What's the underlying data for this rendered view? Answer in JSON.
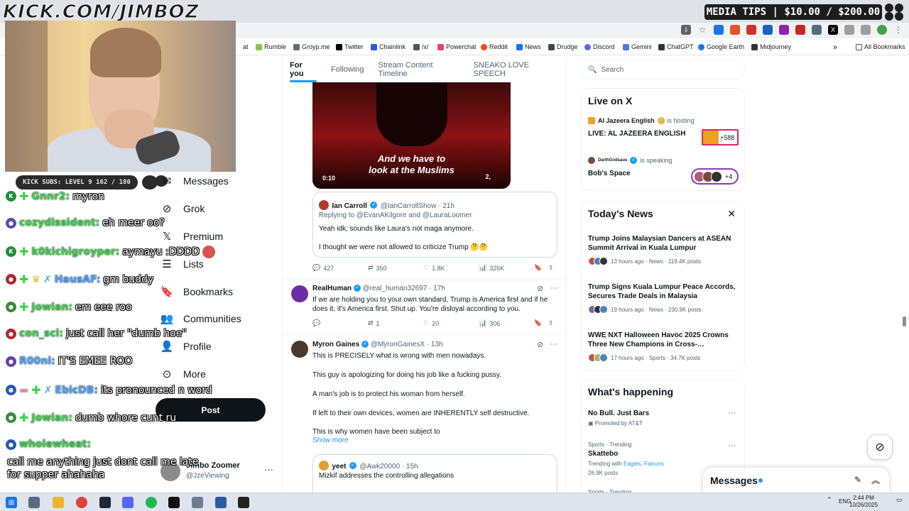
{
  "overlay": {
    "stream_url": "KICK.COM/JIMBOZ",
    "media_tips": "MEDIA TIPS | $10.00 / $200.00",
    "kick_subs": "KICK SUBS: LEVEL 9 162 / 180"
  },
  "bookmarks": [
    {
      "label": "at",
      "color": "#ffffff"
    },
    {
      "label": "Rumble",
      "color": "#85c742"
    },
    {
      "label": "Groyp.me",
      "color": "#6b6b6b"
    },
    {
      "label": "Twitter",
      "color": "#000000"
    },
    {
      "label": "Chainlink",
      "color": "#2a5ada"
    },
    {
      "label": "/x/",
      "color": "#555555"
    },
    {
      "label": "Powerchat",
      "color": "#e0467c"
    },
    {
      "label": "Reddit",
      "color": "#ff4500"
    },
    {
      "label": "News",
      "color": "#1a73e8"
    },
    {
      "label": "Drudge",
      "color": "#444444"
    },
    {
      "label": "Discord",
      "color": "#5865f2"
    },
    {
      "label": "Gemini",
      "color": "#4a7be0"
    },
    {
      "label": "ChatGPT",
      "color": "#333333"
    },
    {
      "label": "Google Earth",
      "color": "#1a73e8"
    },
    {
      "label": "Midjourney",
      "color": "#333333"
    }
  ],
  "all_bookmarks": "All Bookmarks",
  "nav": [
    {
      "label": "Messages",
      "icon": "envelope-icon"
    },
    {
      "label": "Grok",
      "icon": "grok-icon"
    },
    {
      "label": "Premium",
      "icon": "x-logo-icon"
    },
    {
      "label": "Lists",
      "icon": "list-icon"
    },
    {
      "label": "Bookmarks",
      "icon": "bookmark-icon"
    },
    {
      "label": "Communities",
      "icon": "people-icon"
    },
    {
      "label": "Profile",
      "icon": "person-icon"
    },
    {
      "label": "More",
      "icon": "more-circle-icon"
    }
  ],
  "post_button": "Post",
  "account": {
    "name": "Jimbo Zoomer",
    "handle": "@JzeViewing"
  },
  "chat": [
    {
      "user": "Gnnr2:",
      "msg": "myron",
      "user_color": "#3cd24a",
      "badge_color": "#1f8f3a"
    },
    {
      "user": "cozydissident:",
      "msg": "eh meer oo?",
      "user_color": "#3cd24a",
      "badge_color": "#5b4bb0"
    },
    {
      "user": "k0kichigroyper:",
      "msg": "aymayu :DDDD",
      "user_color": "#3cd24a",
      "badge_color": "#1f8f3a"
    },
    {
      "user": "HausAF:",
      "msg": "gm buddy",
      "user_color": "#4aa3ff",
      "badge_color": "#b0262e"
    },
    {
      "user": "Jowian:",
      "msg": "em eee roo",
      "user_color": "#3cd24a",
      "badge_color": "#3a8a3a"
    },
    {
      "user": "con_sci:",
      "msg": "just call her \"dumb hoe\"",
      "user_color": "#3cd24a",
      "badge_color": "#b0262e"
    },
    {
      "user": "R00ni:",
      "msg": "IT'S EMEE ROO",
      "user_color": "#4aa3ff",
      "badge_color": "#6a3fa3"
    },
    {
      "user": "EbicDB:",
      "msg": "its pronounced n word",
      "user_color": "#4aa3ff",
      "badge_color": "#2a5ab0"
    },
    {
      "user": "Jowian:",
      "msg": "dumb whore cunt ru",
      "user_color": "#3cd24a",
      "badge_color": "#3a8a3a"
    },
    {
      "user": "wholewheat:",
      "msg": "",
      "user_color": "#3cd24a",
      "badge_color": "#2a5ab0"
    }
  ],
  "chat_multiline": "call me anything just dont call me late for supper ahahaha",
  "tabs": [
    "For you",
    "Following",
    "Stream Content Timeline",
    "SNEAKO LOVE SPEECH"
  ],
  "video": {
    "caption_line1": "And we have to",
    "caption_line2": "look at the Muslims",
    "time": "0:10",
    "time2": "2,"
  },
  "quote1": {
    "name": "Ian Carroll",
    "handle": "@IanCarrollShow · 21h",
    "replying": "Replying to @EvanAKilgore and @LauraLoomer",
    "line1": "Yeah idk, sounds like Laura's not maga anymore.",
    "line2": "I thought we were not allowed to criticize Trump 🤔🤔"
  },
  "actions1": {
    "replies": "427",
    "reposts": "350",
    "likes": "1.8K",
    "views": "326K"
  },
  "tweet2": {
    "name": "RealHuman",
    "handle": "@real_human32697 · 17h",
    "text": "If we are holding you to your own standard, Trump is America first and if he does it, it's America first. Shut up. You're disloyal according to you."
  },
  "actions2": {
    "replies": "",
    "reposts": "1",
    "likes": "20",
    "views": "306"
  },
  "tweet3": {
    "name": "Myron Gaines",
    "handle": "@MyronGainesX · 13h",
    "lines": [
      "This is PRECISELY what is wrong with men nowadays.",
      "This guy is apologizing for doing his job like a fucking pussy.",
      "A man's job is to protect his woman from herself.",
      "If left to their own devices, women are INHERENTLY self destructive.",
      "This is why women have been subject to"
    ],
    "show_more": "Show more"
  },
  "quote2": {
    "name": "yeet",
    "handle": "@Awk20000 · 15h",
    "text": "Mizkif addresses the controlling allegations"
  },
  "search_placeholder": "Search",
  "live": {
    "title": "Live on X",
    "items": [
      {
        "host": "Al Jazeera English",
        "status": "is hosting",
        "title": "LIVE: AL JAZEERA ENGLISH",
        "count": "+588"
      },
      {
        "host": "DarthGodsaus",
        "status": "is speaking",
        "title": "Bob's Space",
        "count": "+4"
      }
    ]
  },
  "news": {
    "title": "Today's News",
    "items": [
      {
        "title": "Trump Joins Malaysian Dancers at ASEAN Summit Arrival in Kuala Lumpur",
        "meta": "13 hours ago · News · 119.4K posts"
      },
      {
        "title": "Trump Signs Kuala Lumpur Peace Accords, Secures Trade Deals in Malaysia",
        "meta": "19 hours ago · News · 230.9K posts"
      },
      {
        "title": "WWE NXT Halloween Havoc 2025 Crowns Three New Champions in Cross-…",
        "meta": "17 hours ago · Sports · 34.7K posts"
      }
    ]
  },
  "happening": {
    "title": "What's happening",
    "items": [
      {
        "small": "",
        "name": "No Bull. Just Bars",
        "sub": "Promoted by AT&T"
      },
      {
        "small": "Sports · Trending",
        "name": "Skattebo",
        "sub_prefix": "Trending with",
        "link1": "Eagles",
        "link2": "Falcons",
        "posts": "26.9K posts"
      },
      {
        "small": "Sports · Trending",
        "name": "",
        "sub": ""
      }
    ]
  },
  "messages_drawer": "Messages",
  "taskbar": {
    "lang": "ENG",
    "time": "2:44 PM",
    "date": "10/26/2025"
  }
}
